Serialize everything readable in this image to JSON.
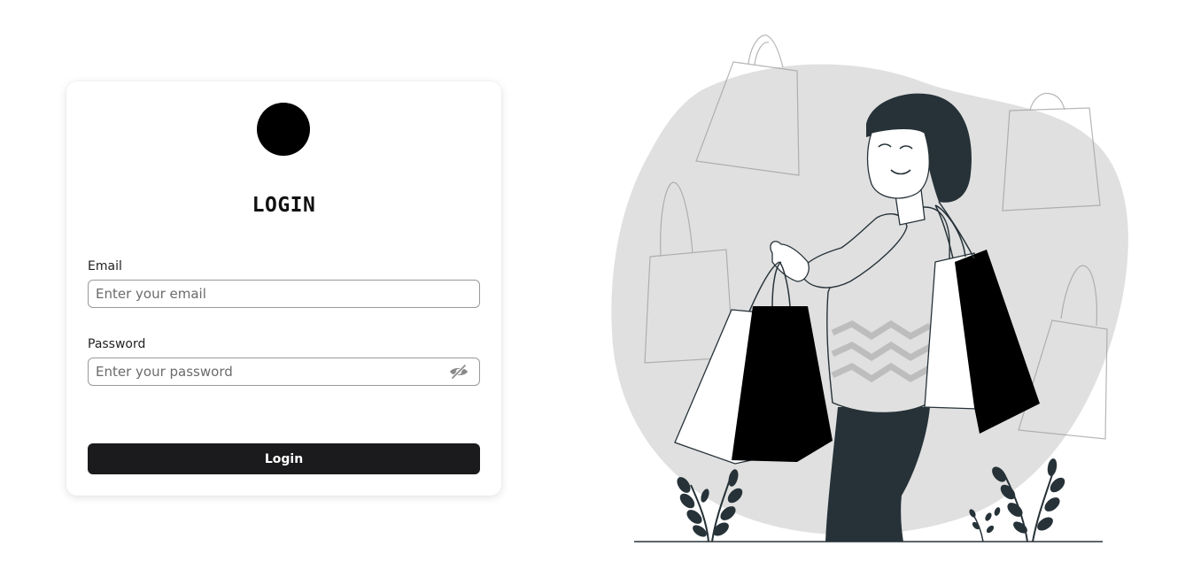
{
  "login": {
    "title": "LOGIN",
    "email_label": "Email",
    "email_placeholder": "Enter your email",
    "password_label": "Password",
    "password_placeholder": "Enter your password",
    "submit_label": "Login",
    "password_toggle_icon": "eye-slash-icon"
  },
  "colors": {
    "button_bg": "#1b1b1d",
    "avatar": "#000000",
    "illustration_blob": "#e0e0e0",
    "illustration_dark": "#263238"
  },
  "illustration": {
    "subject": "shopping-woman-illustration"
  }
}
